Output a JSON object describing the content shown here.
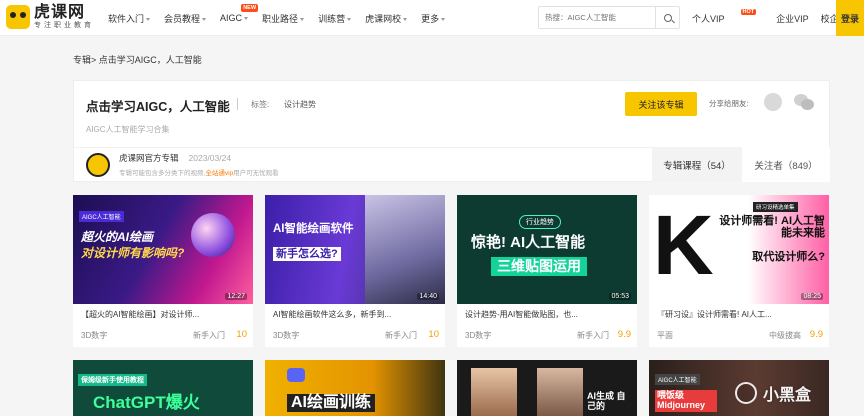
{
  "brand": {
    "name": "虎课网",
    "slogan": "专注职业教育",
    "accent": "#f7c600"
  },
  "nav": {
    "items": [
      {
        "label": "软件入门",
        "caret": true
      },
      {
        "label": "会员教程",
        "caret": true
      },
      {
        "label": "AIGC",
        "caret": true,
        "badge": "NEW"
      },
      {
        "label": "职业路径",
        "caret": true
      },
      {
        "label": "训练营",
        "caret": true
      },
      {
        "label": "虎课网校",
        "caret": true
      },
      {
        "label": "更多",
        "caret": true
      }
    ],
    "search_placeholder": "热搜：AIGC人工智能",
    "right": [
      {
        "label": "个人VIP",
        "badge": "HOT"
      },
      {
        "label": "企业VIP"
      },
      {
        "label": "校企合作"
      }
    ],
    "login": "登录"
  },
  "breadcrumb": "专辑> 点击学习AIGC，人工智能",
  "album": {
    "title": "点击学习AIGC，人工智能",
    "tag_label": "标签:",
    "tag": "设计趋势",
    "subtitle": "AIGC人工智能学习合集",
    "follow_label": "关注该专辑",
    "share_label": "分享给朋友:",
    "author": "虎课网官方专辑",
    "date": "2023/03/24",
    "desc_prefix": "专辑可能包含多分类下的视频,",
    "desc_highlight": "全站通vip",
    "desc_suffix": "用户可无忧观看",
    "tab_courses": "专辑课程（54）",
    "tab_followers": "关注者（849）"
  },
  "courses": [
    {
      "thumb_line1": "超火的AI绘画",
      "thumb_line2": "对设计师有影响吗?",
      "thumb_tag": "AIGC人工智能",
      "duration": "12:27",
      "title": "【超火的AI智能绘画】对设计师...",
      "category": "3D数字",
      "level": "新手入门",
      "score": "10"
    },
    {
      "thumb_line1": "AI智能绘画软件",
      "thumb_line2": "新手怎么选?",
      "thumb_tag": "",
      "duration": "14:40",
      "title": "AI智能绘画软件这么多，新手到...",
      "category": "3D数字",
      "level": "新手入门",
      "score": "10"
    },
    {
      "thumb_line1": "惊艳! AI人工智能",
      "thumb_line2": "三维贴图运用",
      "thumb_tag": "行业趋势",
      "duration": "05:53",
      "title": "设计趋势-用AI智能做贴图，也...",
      "category": "3D数字",
      "level": "新手入门",
      "score": "9.9"
    },
    {
      "thumb_line1": "设计师需看! AI人工智能未来能",
      "thumb_line2": "取代设计师么?",
      "thumb_tag": "研习设精选单集",
      "duration": "08:25",
      "title": "『研习设』设计师需看! AI人工...",
      "category": "平面",
      "level": "中级拔高",
      "score": "9.9"
    }
  ],
  "courses_row2": [
    {
      "thumb_line1": "ChatGPT爆火",
      "thumb_tag": "保姆级新手使用教程"
    },
    {
      "thumb_line1": "AI绘画训练",
      "thumb_tag": ""
    },
    {
      "thumb_line1": "AI生成 自己的",
      "thumb_tag": ""
    },
    {
      "thumb_line1": "喂饭级 Midjourney",
      "thumb_tag": "AIGC人工智能"
    }
  ],
  "watermark": "小黑盒"
}
